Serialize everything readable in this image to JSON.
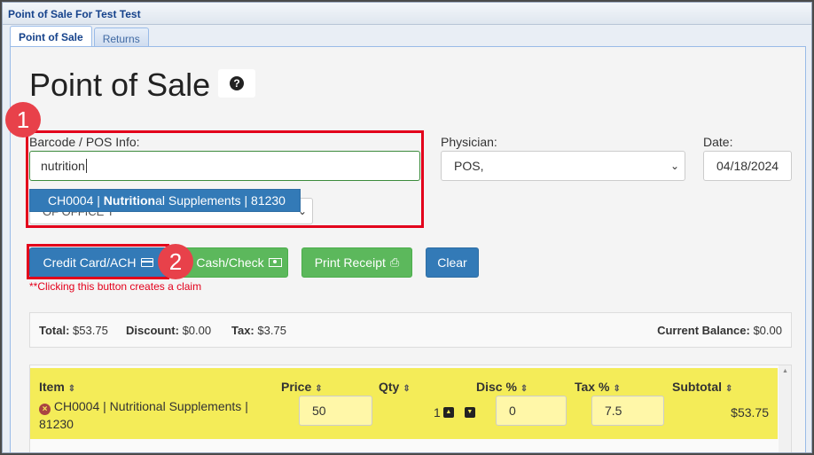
{
  "window": {
    "title": "Point of Sale For Test Test"
  },
  "tabs": [
    {
      "label": "Point of Sale",
      "active": true
    },
    {
      "label": "Returns",
      "active": false
    }
  ],
  "page": {
    "title": "Point of Sale",
    "help_icon": "question-circle-icon"
  },
  "form": {
    "barcode_label": "Barcode / POS Info:",
    "barcode_value": "nutrition",
    "physician_label": "Physician:",
    "physician_value": "POS,",
    "date_label": "Date:",
    "date_value": "04/18/2024",
    "hidden_select_text": "OF OFFICE T"
  },
  "autocomplete": {
    "item_prefix": "CH0004 | ",
    "item_match": "Nutrition",
    "item_suffix": "al Supplements | 81230"
  },
  "annotations": {
    "badge1": "1",
    "badge2": "2",
    "highlight_color": "#e3001b"
  },
  "buttons": {
    "credit_card": "Credit Card/ACH",
    "cash_check": "Cash/Check",
    "print_receipt": "Print Receipt",
    "clear": "Clear"
  },
  "claim_note": "**Clicking this button creates a claim",
  "totals": {
    "total_label": "Total:",
    "total_value": "$53.75",
    "discount_label": "Discount:",
    "discount_value": "$0.00",
    "tax_label": "Tax:",
    "tax_value": "$3.75",
    "balance_label": "Current Balance:",
    "balance_value": "$0.00"
  },
  "grid": {
    "columns": [
      "Item",
      "Price",
      "Qty",
      "Disc %",
      "Tax %",
      "Subtotal"
    ],
    "row": {
      "item_line1": "CH0004 | Nutritional Supplements |",
      "item_line2": "81230",
      "price": "50",
      "qty": "1",
      "disc": "0",
      "tax": "7.5",
      "subtotal": "$53.75"
    },
    "row_color": "#f4ec58"
  }
}
